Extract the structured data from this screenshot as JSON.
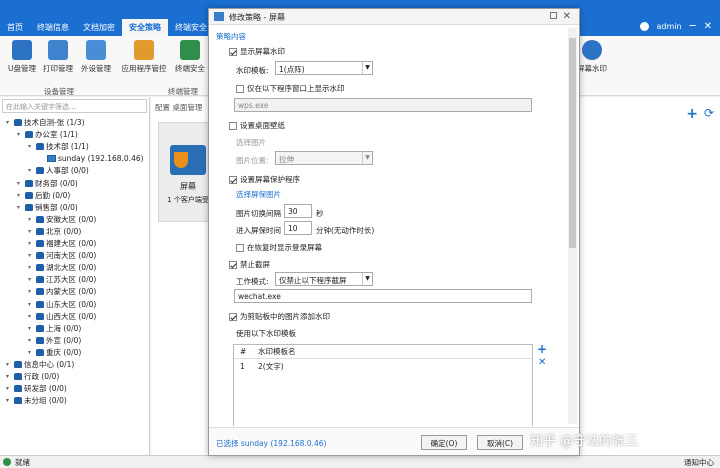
{
  "tabs": [
    "首页",
    "终端信息",
    "文档加密",
    "安全策略",
    "终端安全"
  ],
  "active_tab": 3,
  "user_label": "admin",
  "ribbon": {
    "buttons": [
      "U盘管理",
      "打印管理",
      "外设管理",
      "应用程序管控",
      "终端安全"
    ],
    "right_button": "屏幕水印",
    "group1": "设备管理",
    "group2": "终端管理"
  },
  "left": {
    "search_placeholder": "在此输入关键字筛选...",
    "tree": [
      {
        "label": "技术自测-张 (1/3)",
        "indent": 0,
        "icon": "group"
      },
      {
        "label": "办公室 (1/1)",
        "indent": 1,
        "icon": "group"
      },
      {
        "label": "技术部 (1/1)",
        "indent": 2,
        "icon": "group"
      },
      {
        "label": "sunday (192.168.0.46)",
        "indent": 3,
        "icon": "computer"
      },
      {
        "label": "人事部 (0/0)",
        "indent": 2,
        "icon": "group"
      },
      {
        "label": "财务部 (0/0)",
        "indent": 1,
        "icon": "group"
      },
      {
        "label": "后勤 (0/0)",
        "indent": 1,
        "icon": "group"
      },
      {
        "label": "销售部 (0/0)",
        "indent": 1,
        "icon": "group"
      },
      {
        "label": "安徽大区 (0/0)",
        "indent": 2,
        "icon": "group"
      },
      {
        "label": "北京 (0/0)",
        "indent": 2,
        "icon": "group"
      },
      {
        "label": "福建大区 (0/0)",
        "indent": 2,
        "icon": "group"
      },
      {
        "label": "河南大区 (0/0)",
        "indent": 2,
        "icon": "group"
      },
      {
        "label": "湖北大区 (0/0)",
        "indent": 2,
        "icon": "group"
      },
      {
        "label": "江苏大区 (0/0)",
        "indent": 2,
        "icon": "group"
      },
      {
        "label": "内蒙大区 (0/0)",
        "indent": 2,
        "icon": "group"
      },
      {
        "label": "山东大区 (0/0)",
        "indent": 2,
        "icon": "group"
      },
      {
        "label": "山西大区 (0/0)",
        "indent": 2,
        "icon": "group"
      },
      {
        "label": "上海 (0/0)",
        "indent": 2,
        "icon": "group"
      },
      {
        "label": "外宣 (0/0)",
        "indent": 2,
        "icon": "group"
      },
      {
        "label": "重庆 (0/0)",
        "indent": 2,
        "icon": "group"
      },
      {
        "label": "信息中心 (0/1)",
        "indent": 0,
        "icon": "group"
      },
      {
        "label": "行政 (0/0)",
        "indent": 0,
        "icon": "group"
      },
      {
        "label": "研发部 (0/0)",
        "indent": 0,
        "icon": "group"
      },
      {
        "label": "未分组 (0/0)",
        "indent": 0,
        "icon": "group"
      }
    ]
  },
  "center": {
    "crumb": "配置 桌面管理",
    "card_title": "屏幕",
    "card_sub": "1 个客户端受"
  },
  "status": {
    "left": "就绪",
    "right": "通知中心"
  },
  "dialog": {
    "title": "修改策略 - 屏幕",
    "section": "策略内容",
    "show_watermark": "显示屏幕水印",
    "template_label": "水印模板:",
    "template_value": "1(点阵)",
    "only_in_window": "仅在以下程序窗口上显示水印",
    "window_program": "wps.exe",
    "set_wallpaper": "设置桌面壁纸",
    "choose_image": "选择图片",
    "image_pos_label": "图片位置:",
    "image_pos_value": "拉伸",
    "set_saver": "设置屏幕保护程序",
    "choose_saver_image": "选择屏保图片",
    "interval_label": "图片切换间隔",
    "interval_value": "30",
    "interval_unit": "秒",
    "idle_label": "进入屏保时间",
    "idle_value": "10",
    "idle_unit": "分钟(无动作时长)",
    "show_login_on_resume": "在恢复时显示登录屏幕",
    "forbid_screenshot": "禁止截屏",
    "work_mode_label": "工作模式:",
    "work_mode_value": "仅禁止以下程序截屏",
    "screenshot_program": "wechat.exe",
    "clipboard_watermark": "为剪贴板中的图片添加水印",
    "use_template": "使用以下水印模板",
    "grid_head": [
      "#",
      "水印模板名"
    ],
    "grid_rows": [
      [
        "1",
        "2(文字)"
      ]
    ],
    "selected": "已选择 sunday (192.168.0.46)",
    "ok": "确定(O)",
    "cancel": "取消(C)"
  },
  "watermark_text": "知乎 @守法的张三"
}
